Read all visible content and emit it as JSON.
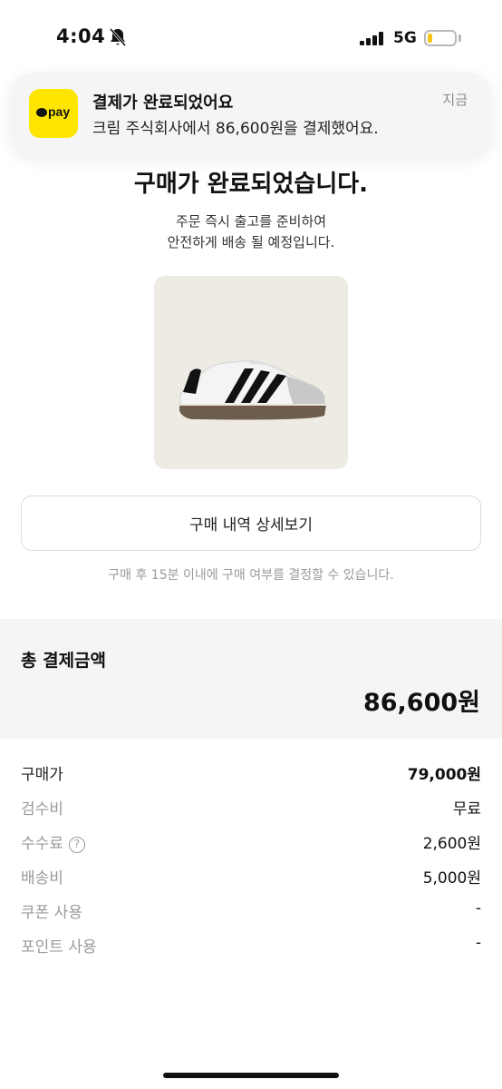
{
  "status_bar": {
    "time": "4:04",
    "network": "5G",
    "battery_color": "#f5c518"
  },
  "notification": {
    "app_icon_text": "pay",
    "title": "결제가 완료되었어요",
    "body": "크림 주식회사에서 86,600원을 결제했어요.",
    "time": "지금",
    "icon_bg": "#fee500"
  },
  "headline": "구매가 완료되었습니다.",
  "subtext": [
    "주문 즉시 출고를 준비하여",
    "안전하게 배송 될 예정입니다."
  ],
  "product": {
    "image": "white-black-stripe-sneaker"
  },
  "detail_button_label": "구매 내역 상세보기",
  "notice": "구매 후 15분 이내에 구매 여부를 결정할 수 있습니다.",
  "total": {
    "label": "총 결제금액",
    "amount": "86,600원"
  },
  "breakdown": [
    {
      "label": "구매가",
      "value": "79,000원"
    },
    {
      "label": "검수비",
      "value": "무료"
    },
    {
      "label": "수수료",
      "value": "2,600원",
      "help_icon": "?"
    },
    {
      "label": "배송비",
      "value": "5,000원"
    },
    {
      "label": "쿠폰 사용",
      "value": "-"
    },
    {
      "label": "포인트 사용",
      "value": "-"
    }
  ]
}
